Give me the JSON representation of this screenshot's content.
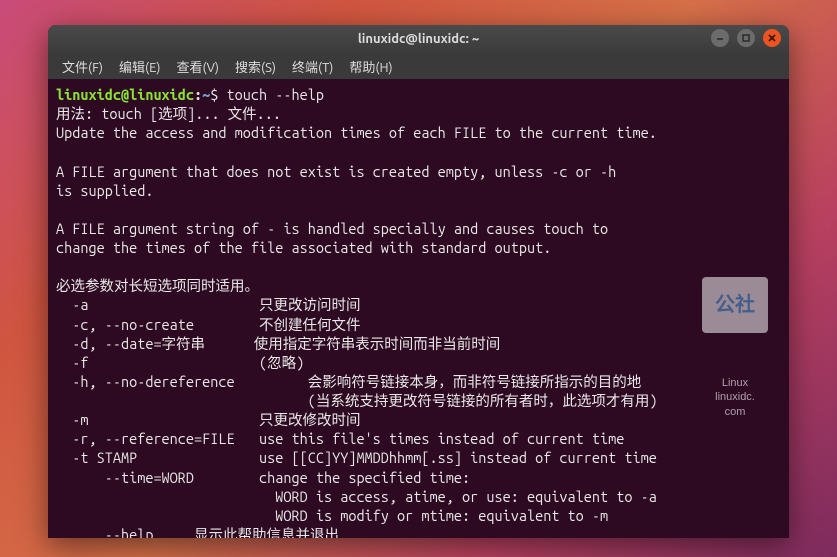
{
  "window": {
    "title": "linuxidc@linuxidc: ~"
  },
  "menu": {
    "file": "文件(F)",
    "edit": "编辑(E)",
    "view": "查看(V)",
    "search": "搜索(S)",
    "terminal": "终端(T)",
    "help": "帮助(H)"
  },
  "prompt": {
    "user_host": "linuxidc@linuxidc",
    "path": "~",
    "symbol": "$",
    "command": "touch --help"
  },
  "output": {
    "l1": "用法: touch [选项]... 文件...",
    "l2": "Update the access and modification times of each FILE to the current time.",
    "l3": "",
    "l4": "A FILE argument that does not exist is created empty, unless -c or -h",
    "l5": "is supplied.",
    "l6": "",
    "l7": "A FILE argument string of - is handled specially and causes touch to",
    "l8": "change the times of the file associated with standard output.",
    "l9": "",
    "l10": "必选参数对长短选项同时适用。",
    "l11": "  -a                     只更改访问时间",
    "l12": "  -c, --no-create        不创建任何文件",
    "l13": "  -d, --date=字符串      使用指定字符串表示时间而非当前时间",
    "l14": "  -f                     (忽略)",
    "l15": "  -h, --no-dereference         会影响符号链接本身，而非符号链接所指示的目的地",
    "l16": "                               (当系统支持更改符号链接的所有者时，此选项才有用)",
    "l17": "  -m                     只更改修改时间",
    "l18": "  -r, --reference=FILE   use this file's times instead of current time",
    "l19": "  -t STAMP               use [[CC]YY]MMDDhhmm[.ss] instead of current time",
    "l20": "      --time=WORD        change the specified time:",
    "l21": "                           WORD is access, atime, or use: equivalent to -a",
    "l22": "                           WORD is modify or mtime: equivalent to -m",
    "l23": "      --help     显示此帮助信息并退出"
  },
  "watermark": {
    "label": "公社",
    "l1": "Linux",
    "l2": "linuxidc.",
    "l3": "com"
  }
}
